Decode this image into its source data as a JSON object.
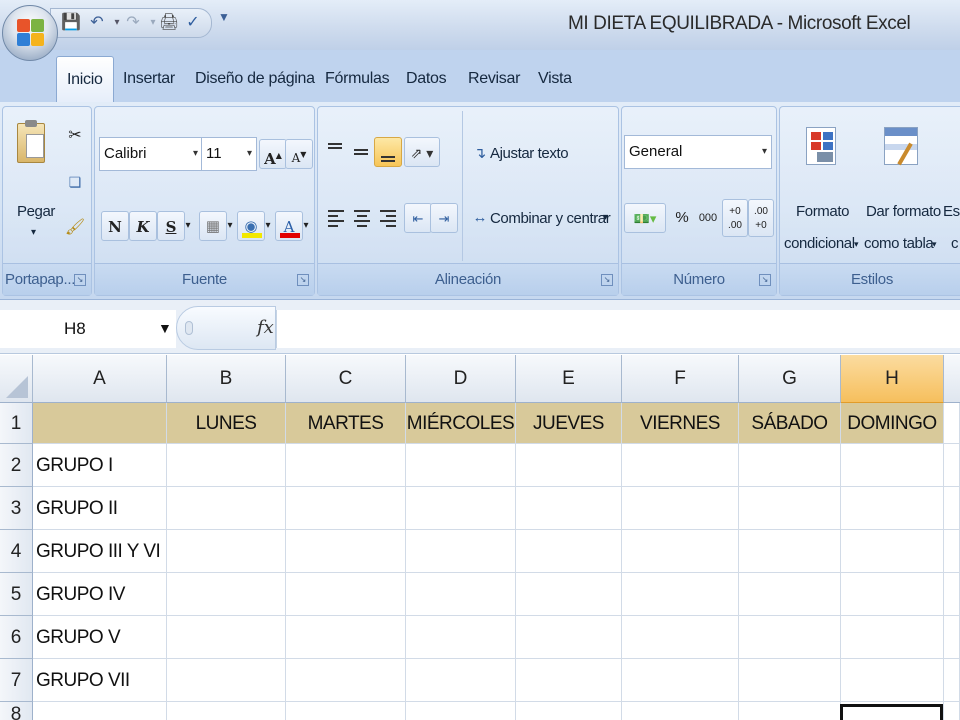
{
  "window": {
    "title": "MI DIETA EQUILIBRADA - Microsoft Excel"
  },
  "colors": {
    "header_row_fill": "#d8c99a",
    "selected_column_header": "#f6bf5d",
    "ribbon_background": "#d5e3f4"
  },
  "quick_access": {
    "icons": [
      "save-icon",
      "undo-icon",
      "redo-icon",
      "print-preview-icon",
      "spelling-icon"
    ]
  },
  "ribbon_tabs": [
    "Inicio",
    "Insertar",
    "Diseño de página",
    "Fórmulas",
    "Datos",
    "Revisar",
    "Vista"
  ],
  "active_tab": "Inicio",
  "ribbon": {
    "portapapeles": {
      "label": "Portapap...",
      "paste_label": "Pegar"
    },
    "fuente": {
      "label": "Fuente",
      "font_name": "Calibri",
      "font_size": "11",
      "grow": "A",
      "shrink": "A",
      "bold": "N",
      "italic": "K",
      "underline": "S",
      "font_color_letter": "A"
    },
    "alineacion": {
      "label": "Alineación",
      "wrap_text": "Ajustar texto",
      "merge_center": "Combinar y centrar"
    },
    "numero": {
      "label": "Número",
      "format": "General",
      "percent": "%",
      "thousands": "000",
      "inc_decimal": "+0 .00",
      "dec_decimal": ".00 +0"
    },
    "estilos": {
      "label": "Estilos",
      "conditional_line1": "Formato",
      "conditional_line2": "condicional",
      "table_line1": "Dar formato",
      "table_line2": "como tabla",
      "cell_styles_line1": "Es",
      "cell_styles_line2": "c"
    }
  },
  "formula_bar": {
    "name_box": "H8",
    "fx": "fx",
    "formula": ""
  },
  "sheet": {
    "columns": [
      "A",
      "B",
      "C",
      "D",
      "E",
      "F",
      "G",
      "H"
    ],
    "selected_column": "H",
    "rows": [
      "1",
      "2",
      "3",
      "4",
      "5",
      "6",
      "7",
      "8"
    ],
    "header_row": [
      "",
      "LUNES",
      "MARTES",
      "MIÉRCOLES",
      "JUEVES",
      "VIERNES",
      "SÁBADO",
      "DOMINGO"
    ],
    "groups": [
      "GRUPO I",
      "GRUPO II",
      "GRUPO III Y VI",
      "GRUPO IV",
      "GRUPO V",
      "GRUPO VII"
    ],
    "active_cell": "H8"
  }
}
